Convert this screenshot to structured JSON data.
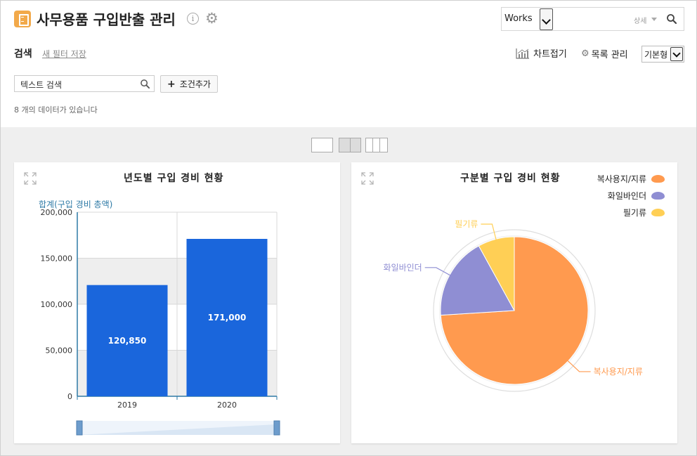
{
  "header": {
    "title": "사무용품 구입반출 관리",
    "info_glyph": "i",
    "search": {
      "app_label": "Works",
      "detail_label": "상세"
    }
  },
  "filter": {
    "title": "검색",
    "save_filter": "새 필터 저장",
    "search_placeholder": "텍스트 검색",
    "add_condition": "조건추가",
    "add_plus": "+",
    "result_count": "8 개의 데이터가 있습니다"
  },
  "toolbar": {
    "chart_fold": "차트접기",
    "list_manage": "목록 관리",
    "view_type": "기본형"
  },
  "charts": {
    "left_title": "년도별 구입 경비 현황",
    "right_title": "구분별 구입 경비 현황"
  },
  "colors": {
    "bar": "#1a66dc",
    "pie_orange": "#ff9a4f",
    "pie_purple": "#8f8ed3",
    "pie_yellow": "#ffcf55",
    "axis_label": "#2e7aa6"
  },
  "chart_data": [
    {
      "type": "bar",
      "title": "년도별 구입 경비 현황",
      "ylabel": "합계(구입 경비 총액)",
      "categories": [
        "2019",
        "2020"
      ],
      "values": [
        120850,
        171000
      ],
      "value_labels": [
        "120,850",
        "171,000"
      ],
      "ylim": [
        0,
        200000
      ],
      "yticks": [
        0,
        50000,
        100000,
        150000,
        200000
      ],
      "ytick_labels": [
        "0",
        "50,000",
        "100,000",
        "150,000",
        "200,000"
      ],
      "grid": true
    },
    {
      "type": "pie",
      "title": "구분별 구입 경비 현황",
      "labels": [
        "복사용지/지류",
        "화일바인더",
        "필기류"
      ],
      "values": [
        74,
        18,
        8
      ],
      "colors": [
        "#ff9a4f",
        "#8f8ed3",
        "#ffcf55"
      ],
      "legend": "top-right"
    }
  ]
}
